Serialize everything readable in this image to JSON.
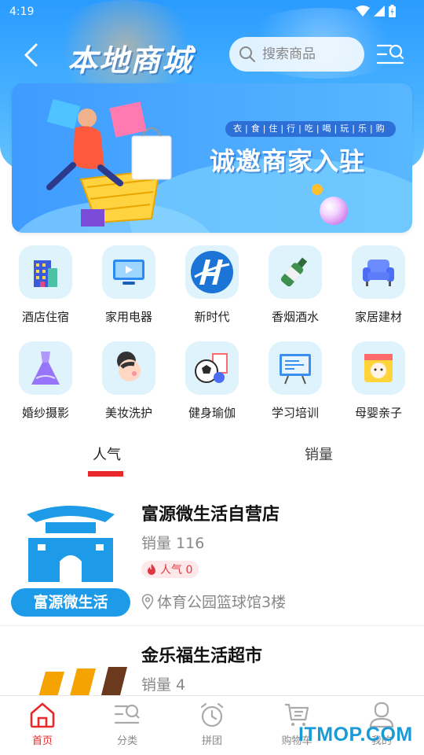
{
  "status": {
    "time": "4:19"
  },
  "header": {
    "title": "本地商城",
    "search_placeholder": "搜索商品"
  },
  "banner": {
    "tags": "衣|食|住|行|吃|喝|玩|乐|购",
    "slogan": "诚邀商家入驻"
  },
  "categories": [
    {
      "label": "酒店住宿",
      "icon": "hotel-icon"
    },
    {
      "label": "家用电器",
      "icon": "tv-icon"
    },
    {
      "label": "新时代",
      "icon": "new-era-logo-icon"
    },
    {
      "label": "香烟酒水",
      "icon": "liquor-bottle-icon"
    },
    {
      "label": "家居建材",
      "icon": "sofa-icon"
    },
    {
      "label": "婚纱摄影",
      "icon": "wedding-dress-icon"
    },
    {
      "label": "美妆洗护",
      "icon": "makeup-face-icon"
    },
    {
      "label": "健身瑜伽",
      "icon": "sports-ball-icon"
    },
    {
      "label": "学习培训",
      "icon": "whiteboard-icon"
    },
    {
      "label": "母婴亲子",
      "icon": "baby-icon"
    }
  ],
  "tabs": {
    "popular": "人气",
    "sales": "销量"
  },
  "stores": [
    {
      "name": "富源微生活自营店",
      "sales": "销量 116",
      "popularity": "人气 0",
      "address": "体育公园篮球馆3楼",
      "logo_text": "富源微生活"
    },
    {
      "name": "金乐福生活超市",
      "sales": "销量 4"
    }
  ],
  "bottom_nav": [
    {
      "label": "首页",
      "icon": "home-icon",
      "active": true
    },
    {
      "label": "分类",
      "icon": "category-search-icon",
      "active": false
    },
    {
      "label": "拼团",
      "icon": "alarm-clock-icon",
      "active": false
    },
    {
      "label": "购物车",
      "icon": "cart-icon",
      "active": false
    },
    {
      "label": "我的",
      "icon": "user-icon",
      "active": false
    }
  ],
  "watermark": "ITMOP.COM",
  "colors": {
    "brand_blue": "#2a9bff",
    "accent_red": "#e8282a",
    "icon_bg": "#dff3fd"
  }
}
